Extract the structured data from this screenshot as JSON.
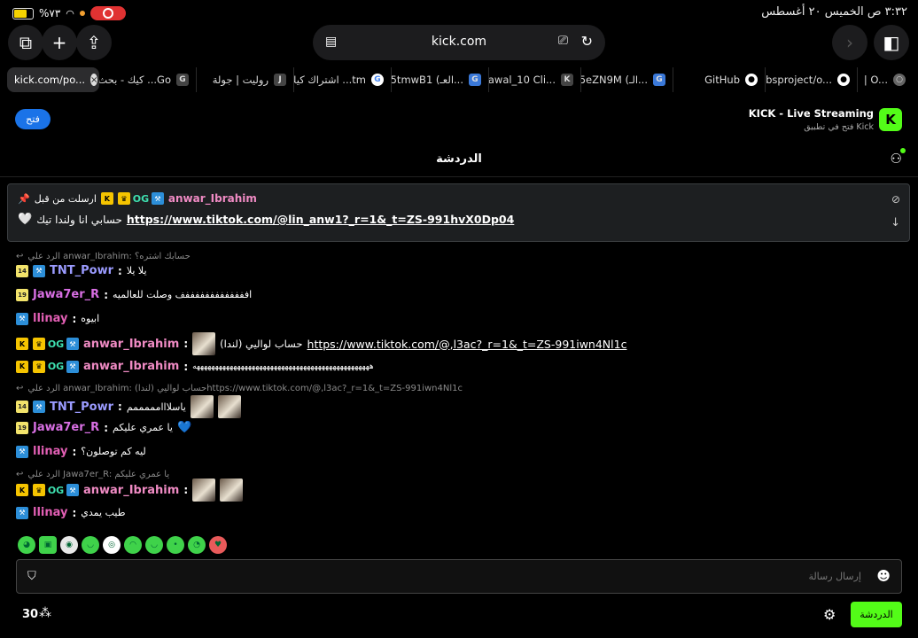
{
  "status_bar": {
    "time": "٣:٣٢ ص  الخميس ٢٠ أغسطس",
    "battery_percent": "%٧٣",
    "battery_level": 0.73
  },
  "browser": {
    "url": "kick.com",
    "tabs": [
      {
        "label": "kick.com/po...",
        "active": true
      },
      {
        "label": "كيك - بحث ...Go",
        "fav": "G"
      },
      {
        "label": "روليت | جولة",
        "fav": "J"
      },
      {
        "label": "اشتراك كيك ...tm",
        "fav": "G"
      },
      {
        "label": "#5tmwB1 (العـ...",
        "fav": "G"
      },
      {
        "label": "nawal_10 Cli...",
        "fav": "K"
      },
      {
        "label": "#5eZN9M (الـ...",
        "fav": "G"
      },
      {
        "label": "GitHub",
        "fav": "gh"
      },
      {
        "label": "obsproject/o...",
        "fav": "gh"
      },
      {
        "label": "| O...",
        "fav": "o"
      }
    ]
  },
  "app_banner": {
    "title": "KICK - Live Streaming",
    "subtitle": "فتح في تطبيق Kick",
    "open_label": "فتح"
  },
  "chat": {
    "title": "الدردشة",
    "pinned": {
      "sent_by_label": "ارسلت من قبل",
      "username": "anwar_Ibrahim",
      "link": "https://www.tiktok.com/@lin_anw1?_r=1&_t=ZS-991hvX0Dp04",
      "text": "حسابي انا ولندا تيك"
    },
    "messages": [
      {
        "reply_to": "الرد علي anwar_Ibrahim: حسابك اشتره؟",
        "username": "TNT_Powr",
        "color": "#9b9bff",
        "text": "يلا يلا"
      },
      {
        "username": "Jawa7er_R",
        "color": "#d86fe3",
        "text": "افففففففففففففف وصلت للعالميه"
      },
      {
        "username": "llinay",
        "color": "#e25fb4",
        "text": "ابيوه"
      },
      {
        "username": "anwar_Ibrahim",
        "color": "#f08bc4",
        "text": "حساب لواليي (لندا)",
        "link": "https://www.tiktok.com/@,l3ac?_r=1&_t=ZS-991iwn4Nl1c"
      },
      {
        "username": "anwar_Ibrahim",
        "color": "#f08bc4",
        "text": "ههههههههههههههههههههههههههههههههههههههههههههههههه"
      },
      {
        "reply_to": "الرد علي anwar_Ibrahim: حساب لواليي (لندا)https://www.tiktok.com/@,l3ac?_r=1&_t=ZS-991iwn4Nl1c",
        "username": "TNT_Powr",
        "color": "#9b9bff",
        "text": "ياسلااامممممم"
      },
      {
        "username": "Jawa7er_R",
        "color": "#d86fe3",
        "text": "يا عمري عليكم"
      },
      {
        "username": "llinay",
        "color": "#e25fb4",
        "text": "ليه كم توصلون؟"
      },
      {
        "reply_to": "الرد علي Jawa7er_R: يا عمري عليكم",
        "username": "anwar_Ibrahim",
        "color": "#f08bc4",
        "text": ""
      },
      {
        "username": "llinay",
        "color": "#e25fb4",
        "text": "طيب يمدي"
      }
    ],
    "input_placeholder": "إرسال رسالة",
    "send_label": "الدردشة",
    "viewer_count": "30"
  }
}
